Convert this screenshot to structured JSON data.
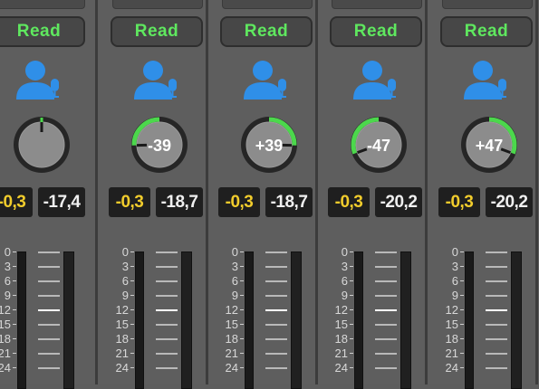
{
  "colors": {
    "automation_green": "#5fe85f",
    "pan_arc_green": "#4cd84c",
    "user_icon_blue": "#2f8fe8",
    "gain_yellow": "#f1cc2c",
    "value_white": "#f0f0f0",
    "strip_bg": "#5e5e5e"
  },
  "scale_labels": [
    "0",
    "3",
    "6",
    "9",
    "12",
    "15",
    "18",
    "21",
    "24"
  ],
  "strips": [
    {
      "automation": "Read",
      "icon": "user-mic-icon",
      "pan_label": "",
      "pan_value": 0,
      "gain": "-0,3",
      "level": "-17,4"
    },
    {
      "automation": "Read",
      "icon": "user-mic-icon",
      "pan_label": "-39",
      "pan_value": -39,
      "gain": "-0,3",
      "level": "-18,7"
    },
    {
      "automation": "Read",
      "icon": "user-mic-icon",
      "pan_label": "+39",
      "pan_value": 39,
      "gain": "-0,3",
      "level": "-18,7"
    },
    {
      "automation": "Read",
      "icon": "user-mic-icon",
      "pan_label": "-47",
      "pan_value": -47,
      "gain": "-0,3",
      "level": "-20,2"
    },
    {
      "automation": "Read",
      "icon": "user-mic-icon",
      "pan_label": "+47",
      "pan_value": 47,
      "gain": "-0,3",
      "level": "-20,2"
    }
  ]
}
